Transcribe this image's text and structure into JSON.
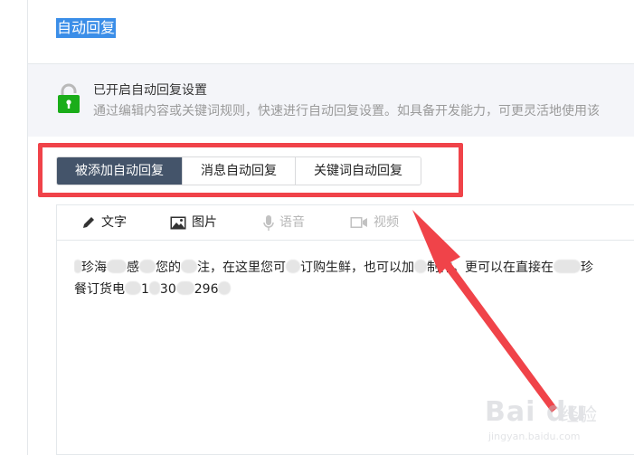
{
  "page": {
    "title": "自动回复"
  },
  "banner": {
    "title": "已开启自动回复设置",
    "description": "通过编辑内容或关键词规则，快速进行自动回复设置。如具备开发能力，可更灵活地使用该"
  },
  "tabs": [
    {
      "label": "被添加自动回复",
      "active": true
    },
    {
      "label": "消息自动回复",
      "active": false
    },
    {
      "label": "关键词自动回复",
      "active": false
    }
  ],
  "toolbar": {
    "text": "文字",
    "image": "图片",
    "voice": "语音",
    "video": "视频"
  },
  "content": {
    "line1": {
      "a": "珍海",
      "b": "感",
      "c": "您的",
      "d": "注，在这里您可",
      "e": "订购生鲜，也可以加",
      "f": "制作。更可以在直接在",
      "g": "珍"
    },
    "line2": {
      "a": "餐订货电",
      "b": "1",
      "c": "30",
      "d": "296"
    }
  },
  "watermark": {
    "logo": "Bai du",
    "text": "经验",
    "url": "jingyan.baidu.com"
  },
  "colors": {
    "accent_highlight": "#3b8ee8",
    "active_tab": "#44546a",
    "annotation_red": "#f04349",
    "lock_green": "#1aad19"
  }
}
